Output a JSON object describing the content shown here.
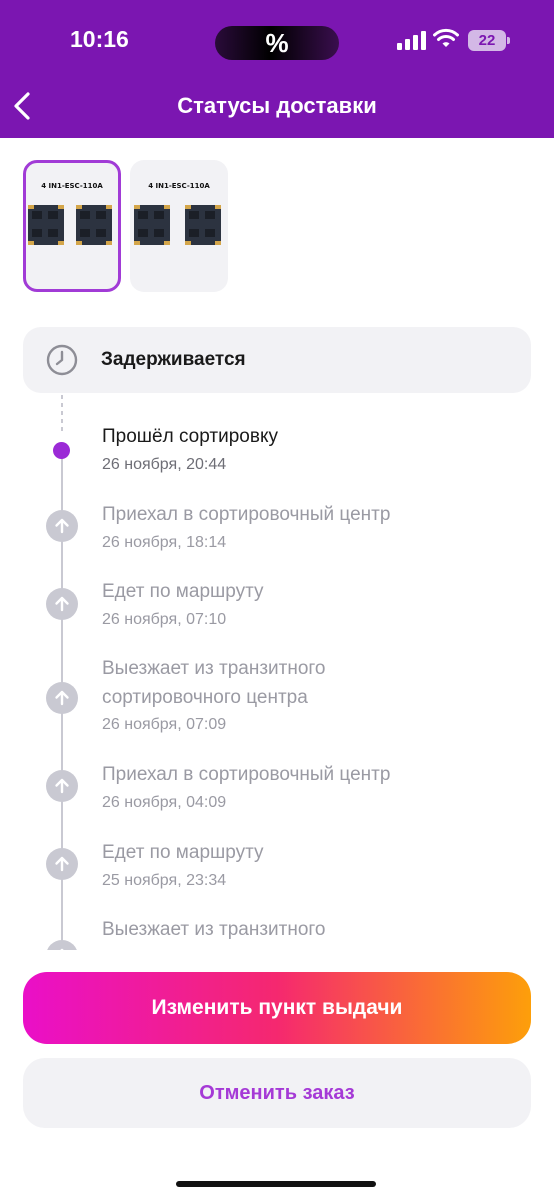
{
  "status_bar": {
    "time": "10:16",
    "island_text": "%",
    "battery": "22"
  },
  "header": {
    "title": "Статусы доставки",
    "back_icon": "chevron-left-icon",
    "background_color": "#7b16b1"
  },
  "products": [
    {
      "label": "4 IN1-ESC-110A",
      "selected": true
    },
    {
      "label": "4 IN1-ESC-110A",
      "selected": false
    }
  ],
  "delay": {
    "icon": "clock-icon",
    "text": "Задерживается"
  },
  "timeline": [
    {
      "title": "Прошёл сортировку",
      "date": "26 ноября, 20:44",
      "active": true
    },
    {
      "title": "Приехал в сортировочный центр",
      "date": "26 ноября, 18:14",
      "active": false
    },
    {
      "title": "Едет по маршруту",
      "date": "26 ноября, 07:10",
      "active": false
    },
    {
      "title_line1": "Выезжает из транзитного",
      "title_line2": "сортировочного центра",
      "date": "26 ноября, 07:09",
      "active": false
    },
    {
      "title": "Приехал в сортировочный центр",
      "date": "26 ноября, 04:09",
      "active": false
    },
    {
      "title": "Едет по маршруту",
      "date": "25 ноября, 23:34",
      "active": false
    },
    {
      "title": "Выезжает из транзитного",
      "active": false
    }
  ],
  "actions": {
    "change_pickup": "Изменить пункт выдачи",
    "cancel_order": "Отменить заказ"
  },
  "colors": {
    "accent": "#9b2ad6",
    "primary_gradient_start": "#ea0fc8",
    "primary_gradient_end": "#fd9f0a"
  }
}
